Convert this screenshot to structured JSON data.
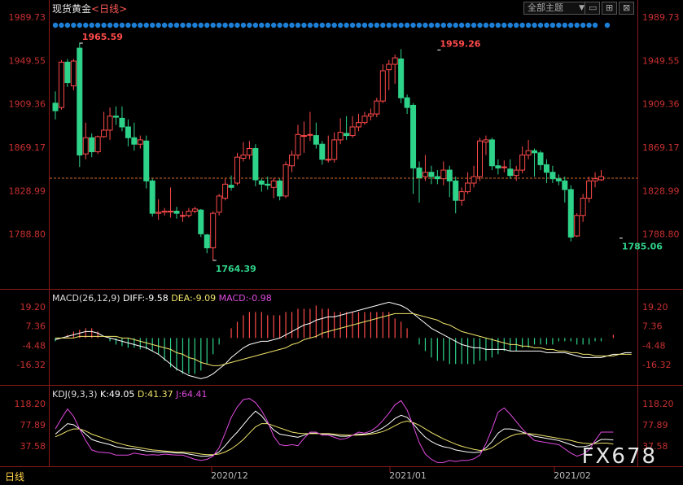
{
  "header": {
    "instrument": "现货黄金",
    "period": "<日线>",
    "theme_button": "全部主题",
    "dropdown_arrow": "▼",
    "minimize": "▭",
    "maximize": "⊞",
    "close": "⊠"
  },
  "macd_legend": {
    "name": "MACD(26,12,9)",
    "diff": "DIFF:-9.58",
    "dea": "DEA:-9.09",
    "macd": "MACD:-0.98"
  },
  "kdj_legend": {
    "name": "KDJ(9,3,3)",
    "k": "K:49.05",
    "d": "D:41.37",
    "j": "J:64.41"
  },
  "watermark": "FX678",
  "period_tag": "日线",
  "colors": {
    "up": "#ff4a4a",
    "down": "#2ed38a",
    "diff": "#ffffff",
    "dea": "#f0e36a",
    "macd": "#e04be0",
    "axis": "#c83030",
    "dot": "#1e7fd6"
  },
  "chart_data": [
    {
      "type": "candlestick",
      "title": "现货黄金 <日线>",
      "y_ticks": [
        "1989.73",
        "1949.55",
        "1909.36",
        "1869.17",
        "1828.99",
        "1788.80"
      ],
      "ylim": [
        1765,
        2000
      ],
      "x_ticks": [
        "2020/12",
        "2021/01",
        "2021/02"
      ],
      "annotations": [
        {
          "text": "1965.59",
          "value": 1965.59,
          "index": 4
        },
        {
          "text": "1764.39",
          "value": 1764.39,
          "index": 26
        },
        {
          "text": "1959.26",
          "value": 1959.26,
          "index": 63
        },
        {
          "text": "1785.06",
          "value": 1785.06,
          "index": 93
        }
      ],
      "reference_line": 1840.5,
      "candles": [
        [
          1910,
          1903,
          1921,
          1895
        ],
        [
          1906,
          1948,
          1950,
          1904
        ],
        [
          1948,
          1929,
          1951,
          1925
        ],
        [
          1926,
          1949,
          1951,
          1922
        ],
        [
          1961,
          1862,
          1966,
          1851
        ],
        [
          1863,
          1878,
          1892,
          1858
        ],
        [
          1878,
          1865,
          1882,
          1860
        ],
        [
          1865,
          1879,
          1880,
          1863
        ],
        [
          1879,
          1885,
          1902,
          1878
        ],
        [
          1885,
          1898,
          1906,
          1876
        ],
        [
          1898,
          1897,
          1907,
          1890
        ],
        [
          1896,
          1888,
          1907,
          1884
        ],
        [
          1888,
          1878,
          1895,
          1870
        ],
        [
          1878,
          1872,
          1892,
          1866
        ],
        [
          1872,
          1876,
          1880,
          1868
        ],
        [
          1875,
          1838,
          1880,
          1831
        ],
        [
          1838,
          1808,
          1840,
          1805
        ],
        [
          1808,
          1809,
          1821,
          1802
        ],
        [
          1809,
          1810,
          1813,
          1806
        ],
        [
          1810,
          1810,
          1832,
          1804
        ],
        [
          1810,
          1808,
          1814,
          1803
        ],
        [
          1806,
          1806,
          1810,
          1800
        ],
        [
          1806,
          1810,
          1813,
          1804
        ],
        [
          1810,
          1812,
          1814,
          1808
        ],
        [
          1811,
          1789,
          1812,
          1786
        ],
        [
          1788,
          1776,
          1789,
          1771
        ],
        [
          1776,
          1808,
          1810,
          1764
        ],
        [
          1809,
          1824,
          1826,
          1806
        ],
        [
          1822,
          1835,
          1840,
          1820
        ],
        [
          1834,
          1832,
          1843,
          1829
        ],
        [
          1836,
          1860,
          1864,
          1834
        ],
        [
          1859,
          1862,
          1874,
          1856
        ],
        [
          1862,
          1868,
          1875,
          1858
        ],
        [
          1868,
          1839,
          1872,
          1833
        ],
        [
          1838,
          1835,
          1840,
          1828
        ],
        [
          1835,
          1834,
          1842,
          1830
        ],
        [
          1832,
          1838,
          1841,
          1822
        ],
        [
          1838,
          1824,
          1840,
          1820
        ],
        [
          1824,
          1853,
          1856,
          1822
        ],
        [
          1852,
          1862,
          1866,
          1846
        ],
        [
          1862,
          1881,
          1890,
          1858
        ],
        [
          1880,
          1880,
          1893,
          1864
        ],
        [
          1881,
          1881,
          1902,
          1875
        ],
        [
          1880,
          1872,
          1892,
          1868
        ],
        [
          1872,
          1858,
          1875,
          1853
        ],
        [
          1858,
          1858,
          1880,
          1855
        ],
        [
          1858,
          1876,
          1883,
          1855
        ],
        [
          1876,
          1883,
          1896,
          1872
        ],
        [
          1882,
          1880,
          1898,
          1876
        ],
        [
          1880,
          1888,
          1898,
          1878
        ],
        [
          1888,
          1892,
          1900,
          1884
        ],
        [
          1892,
          1898,
          1902,
          1890
        ],
        [
          1898,
          1900,
          1905,
          1894
        ],
        [
          1900,
          1912,
          1915,
          1897
        ],
        [
          1912,
          1940,
          1946,
          1910
        ],
        [
          1941,
          1946,
          1950,
          1922
        ],
        [
          1946,
          1952,
          1955,
          1928
        ],
        [
          1951,
          1915,
          1960,
          1910
        ],
        [
          1915,
          1906,
          1918,
          1900
        ],
        [
          1908,
          1850,
          1910,
          1826
        ],
        [
          1850,
          1841,
          1856,
          1818
        ],
        [
          1842,
          1846,
          1862,
          1838
        ],
        [
          1846,
          1842,
          1852,
          1835
        ],
        [
          1842,
          1840,
          1848,
          1835
        ],
        [
          1840,
          1848,
          1856,
          1834
        ],
        [
          1848,
          1838,
          1852,
          1823
        ],
        [
          1838,
          1820,
          1842,
          1808
        ],
        [
          1820,
          1828,
          1832,
          1815
        ],
        [
          1828,
          1836,
          1846,
          1826
        ],
        [
          1836,
          1842,
          1852,
          1832
        ],
        [
          1842,
          1875,
          1878,
          1838
        ],
        [
          1874,
          1876,
          1880,
          1862
        ],
        [
          1876,
          1852,
          1878,
          1848
        ],
        [
          1852,
          1850,
          1858,
          1844
        ],
        [
          1851,
          1851,
          1857,
          1846
        ],
        [
          1849,
          1843,
          1858,
          1840
        ],
        [
          1843,
          1848,
          1852,
          1838
        ],
        [
          1848,
          1862,
          1870,
          1845
        ],
        [
          1862,
          1866,
          1876,
          1858
        ],
        [
          1866,
          1864,
          1868,
          1842
        ],
        [
          1864,
          1853,
          1866,
          1848
        ],
        [
          1853,
          1846,
          1858,
          1836
        ],
        [
          1846,
          1840,
          1852,
          1836
        ],
        [
          1840,
          1838,
          1844,
          1834
        ],
        [
          1838,
          1830,
          1842,
          1818
        ],
        [
          1830,
          1786,
          1834,
          1782
        ],
        [
          1787,
          1806,
          1808,
          1786
        ],
        [
          1806,
          1822,
          1826,
          1800
        ],
        [
          1822,
          1838,
          1842,
          1818
        ],
        [
          1838,
          1840,
          1846,
          1832
        ],
        [
          1839,
          1842,
          1848,
          1838
        ]
      ]
    },
    {
      "type": "line+bar",
      "name": "MACD(26,12,9)",
      "y_ticks": [
        "19.20",
        "7.36",
        "-4.48",
        "-16.32"
      ],
      "ylim": [
        -22,
        26
      ],
      "series": [
        {
          "name": "DIFF",
          "values": [
            -1,
            0,
            1,
            2,
            3,
            4,
            4,
            3,
            1,
            0,
            -1,
            -2,
            -3,
            -4,
            -5,
            -6,
            -8,
            -10,
            -13,
            -16,
            -19,
            -21,
            -23,
            -24,
            -25,
            -24,
            -22,
            -19,
            -16,
            -12,
            -9,
            -6,
            -4,
            -3,
            -2,
            -2,
            -1,
            0,
            2,
            4,
            6,
            8,
            9,
            11,
            12,
            13,
            13,
            14,
            15,
            16,
            17,
            18,
            19,
            20,
            21,
            22,
            21,
            20,
            18,
            15,
            12,
            9,
            6,
            4,
            2,
            0,
            -2,
            -4,
            -5,
            -6,
            -6,
            -7,
            -7,
            -7,
            -7,
            -8,
            -8,
            -8,
            -8,
            -8,
            -8,
            -9,
            -9,
            -9,
            -9,
            -10,
            -11,
            -12,
            -12,
            -12,
            -12,
            -11,
            -10,
            -10,
            -9,
            -9
          ]
        },
        {
          "name": "DEA",
          "values": [
            0,
            0,
            0,
            0,
            1,
            1,
            1,
            1,
            1,
            1,
            1,
            0,
            0,
            -1,
            -2,
            -3,
            -4,
            -5,
            -6,
            -7,
            -9,
            -10,
            -12,
            -13,
            -15,
            -16,
            -17,
            -17,
            -16,
            -15,
            -14,
            -13,
            -12,
            -11,
            -10,
            -9,
            -8,
            -7,
            -6,
            -4,
            -3,
            -1,
            0,
            1,
            3,
            4,
            5,
            6,
            7,
            8,
            9,
            10,
            11,
            12,
            13,
            14,
            15,
            15,
            15,
            15,
            14,
            13,
            12,
            11,
            9,
            8,
            6,
            4,
            3,
            2,
            1,
            0,
            -1,
            -2,
            -3,
            -4,
            -4,
            -5,
            -5,
            -6,
            -6,
            -7,
            -7,
            -8,
            -8,
            -9,
            -9,
            -10,
            -10,
            -11,
            -11,
            -11,
            -11,
            -10,
            -10,
            -10
          ]
        },
        {
          "name": "MACD",
          "values": [
            -2,
            0,
            2,
            4,
            5,
            6,
            6,
            4,
            0,
            -2,
            -4,
            -5,
            -6,
            -6,
            -7,
            -7,
            -8,
            -10,
            -14,
            -18,
            -20,
            -22,
            -22,
            -22,
            -20,
            -16,
            -10,
            -4,
            0,
            6,
            10,
            14,
            16,
            16,
            16,
            14,
            14,
            14,
            16,
            16,
            18,
            18,
            18,
            20,
            18,
            18,
            16,
            16,
            16,
            16,
            16,
            16,
            16,
            16,
            16,
            16,
            12,
            10,
            6,
            0,
            -4,
            -8,
            -12,
            -14,
            -14,
            -16,
            -16,
            -16,
            -16,
            -16,
            -14,
            -14,
            -12,
            -10,
            -8,
            -8,
            -8,
            -6,
            -6,
            -4,
            -4,
            -4,
            -4,
            -2,
            -2,
            -2,
            -4,
            -4,
            -4,
            -2,
            -2,
            0,
            2,
            0,
            0,
            0
          ]
        }
      ]
    },
    {
      "type": "line",
      "name": "KDJ(9,3,3)",
      "y_ticks": [
        "118.20",
        "77.89",
        "37.58"
      ],
      "ylim": [
        -4,
        130
      ],
      "series": [
        {
          "name": "K",
          "values": [
            60,
            70,
            80,
            78,
            70,
            60,
            50,
            46,
            43,
            40,
            36,
            34,
            32,
            32,
            30,
            28,
            27,
            26,
            26,
            25,
            24,
            24,
            22,
            20,
            18,
            18,
            20,
            26,
            38,
            52,
            64,
            78,
            92,
            104,
            95,
            80,
            68,
            60,
            58,
            56,
            54,
            58,
            62,
            62,
            60,
            60,
            58,
            56,
            56,
            58,
            60,
            60,
            62,
            66,
            72,
            80,
            90,
            96,
            92,
            80,
            66,
            54,
            46,
            40,
            36,
            34,
            30,
            28,
            26,
            25,
            26,
            34,
            46,
            62,
            70,
            70,
            68,
            64,
            60,
            56,
            54,
            52,
            50,
            48,
            44,
            40,
            36,
            36,
            38,
            44,
            50,
            50,
            49
          ]
        },
        {
          "name": "D",
          "values": [
            55,
            60,
            66,
            70,
            70,
            66,
            60,
            56,
            52,
            48,
            44,
            41,
            38,
            36,
            34,
            32,
            30,
            29,
            28,
            27,
            26,
            26,
            25,
            24,
            22,
            21,
            21,
            22,
            26,
            32,
            40,
            50,
            62,
            74,
            80,
            80,
            76,
            72,
            68,
            64,
            62,
            61,
            61,
            61,
            61,
            61,
            60,
            59,
            58,
            58,
            58,
            59,
            60,
            62,
            65,
            70,
            76,
            82,
            85,
            82,
            77,
            70,
            63,
            57,
            51,
            46,
            41,
            37,
            34,
            31,
            29,
            30,
            34,
            42,
            50,
            56,
            60,
            61,
            61,
            60,
            58,
            56,
            54,
            52,
            50,
            48,
            45,
            43,
            42,
            42,
            43,
            43,
            41
          ]
        },
        {
          "name": "J",
          "values": [
            70,
            90,
            108,
            94,
            70,
            48,
            30,
            26,
            25,
            24,
            20,
            20,
            20,
            24,
            22,
            20,
            21,
            20,
            22,
            21,
            20,
            20,
            16,
            12,
            10,
            12,
            18,
            34,
            62,
            92,
            112,
            126,
            128,
            120,
            105,
            84,
            56,
            40,
            38,
            40,
            38,
            52,
            64,
            64,
            58,
            58,
            54,
            50,
            52,
            58,
            64,
            62,
            66,
            74,
            86,
            100,
            116,
            124,
            106,
            76,
            44,
            22,
            12,
            6,
            6,
            10,
            8,
            10,
            10,
            13,
            20,
            42,
            70,
            102,
            110,
            98,
            84,
            70,
            58,
            48,
            46,
            44,
            42,
            40,
            32,
            24,
            18,
            22,
            30,
            48,
            64,
            64,
            64
          ]
        }
      ]
    }
  ]
}
